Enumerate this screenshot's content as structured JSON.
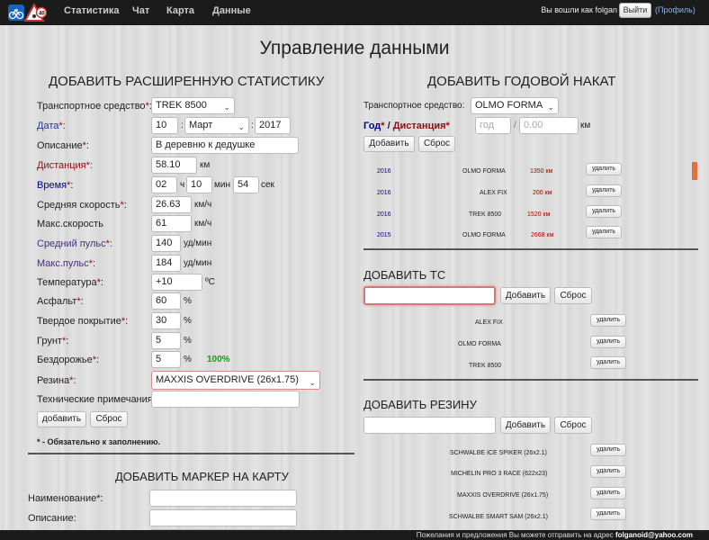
{
  "nav": {
    "items": [
      "Статистика",
      "Чат",
      "Карта",
      "Данные"
    ],
    "login_text": "Вы вошли как folgan",
    "logout": "Выйти",
    "profile": "(Профиль)"
  },
  "page_title": "Управление данными",
  "stats": {
    "title": "ДОБАВИТЬ РАСШИРЕННУЮ СТАТИСТИКУ",
    "vehicle_label": "Транспортное средство",
    "vehicle_value": "TREK 8500",
    "date_label": "Дата",
    "date_day": "10",
    "date_month": "Март",
    "date_year": "2017",
    "desc_label": "Описание",
    "desc_value": "В деревню к дедушке",
    "dist_label": "Дистанция",
    "dist_value": "58.10",
    "dist_unit": "км",
    "time_label": "Время",
    "time_h": "02",
    "time_h_unit": "ч",
    "time_m": "10",
    "time_m_unit": "мин",
    "time_s": "54",
    "time_s_unit": "сек",
    "avgspeed_label": "Средняя скорость",
    "avgspeed_value": "26.63",
    "avgspeed_unit": "км/ч",
    "maxspeed_label": "Макс.скорость",
    "maxspeed_value": "61",
    "maxspeed_unit": "км/ч",
    "avgpulse_label": "Средний пульс",
    "avgpulse_value": "140",
    "avgpulse_unit": "уд/мин",
    "maxpulse_label": "Макс.пульс",
    "maxpulse_value": "184",
    "maxpulse_unit": "уд/мин",
    "temp_label": "Температура",
    "temp_value": "+10",
    "temp_unit": "ºС",
    "asphalt_label": "Асфальт",
    "asphalt_value": "60",
    "hard_label": "Твердое покрытие",
    "hard_value": "30",
    "ground_label": "Грунт",
    "ground_value": "5",
    "offroad_label": "Бездорожье",
    "offroad_value": "5",
    "total": "100%",
    "pct": "%",
    "tire_label": "Резина",
    "tire_value": "MAXXIS OVERDRIVE (26x1.75)",
    "notes_label": "Технические примечания:",
    "add_btn": "добавить",
    "reset_btn": "Сброс",
    "required_note": "* - Обязательно к заполнению."
  },
  "marker": {
    "title": "ДОБАВИТЬ МАРКЕР НА КАРТУ",
    "name_label": "Наименование",
    "desc_label": "Описание:"
  },
  "yearly": {
    "title": "ДОБАВИТЬ ГОДОВОЙ НАКАТ",
    "vehicle_label": "Транспортное средство:",
    "vehicle_value": "OLMO FORMA",
    "year_label": "Год",
    "dist_label": "Дистанция",
    "year_ph": "год",
    "dist_ph": "0.00",
    "unit": "км",
    "add_btn": "Добавить",
    "reset_btn": "Сброс",
    "rows": [
      {
        "year": "2016",
        "vehicle": "OLMO FORMA",
        "dist": "1350 км"
      },
      {
        "year": "2016",
        "vehicle": "ALEX FIX",
        "dist": "200 км"
      },
      {
        "year": "2016",
        "vehicle": "TREK 8500",
        "dist": "1520 км"
      },
      {
        "year": "2015",
        "vehicle": "OLMO FORMA",
        "dist": "2668 км"
      }
    ],
    "delete": "удалить"
  },
  "vehicles": {
    "title": "ДОБАВИТЬ ТС",
    "add_btn": "Добавить",
    "reset_btn": "Сброс",
    "items": [
      "ALEX FIX",
      "OLMO FORMA",
      "TREK 8500"
    ],
    "delete": "удалить"
  },
  "tires": {
    "title": "ДОБАВИТЬ РЕЗИНУ",
    "add_btn": "Добавить",
    "reset_btn": "Сброс",
    "items": [
      "SCHWALBE ICE SPIKER (26x2.1)",
      "MICHELIN PRO 3 RACE (622x23)",
      "MAXXIS OVERDRIVE (26x1.75)",
      "SCHWALBE SMART SAM (26x2.1)"
    ],
    "delete": "удалить"
  },
  "footer": {
    "text": "Пожелания и предложения Вы можете отправить на адрес ",
    "email": "folganoid@yahoo.com"
  }
}
